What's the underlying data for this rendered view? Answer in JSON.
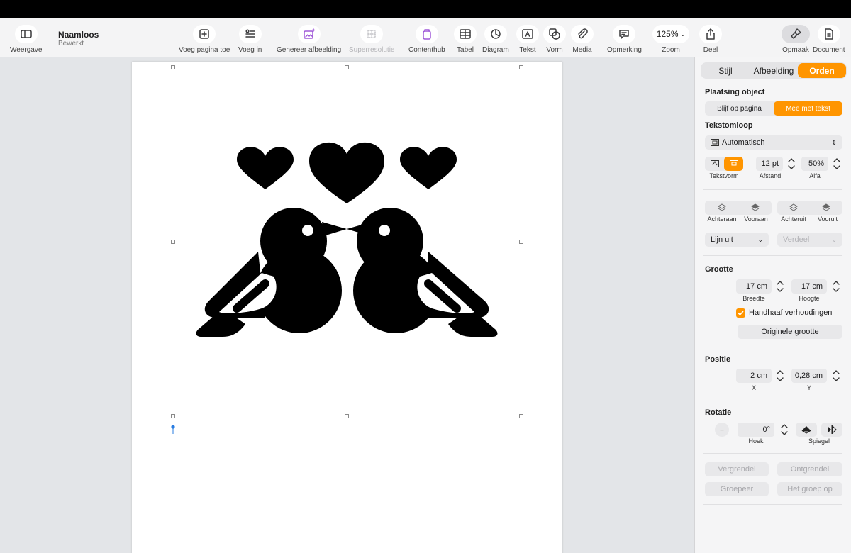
{
  "toolbar": {
    "view_label": "Weergave",
    "doc_title": "Naamloos",
    "doc_status": "Bewerkt",
    "add_page_label": "Voeg pagina toe",
    "insert_label": "Voeg in",
    "generate_image_label": "Genereer afbeelding",
    "super_resolution_label": "Superresolutie",
    "content_hub_label": "Contenthub",
    "table_label": "Tabel",
    "chart_label": "Diagram",
    "text_label": "Tekst",
    "shape_label": "Vorm",
    "media_label": "Media",
    "comment_label": "Opmerking",
    "zoom_value": "125%",
    "zoom_label": "Zoom",
    "share_label": "Deel",
    "format_label": "Opmaak",
    "document_label": "Document"
  },
  "sidebar": {
    "tabs": [
      "Stijl",
      "Afbeelding",
      "Orden"
    ],
    "placement_title": "Plaatsing object",
    "placement_options": [
      "Blijf op pagina",
      "Mee met tekst"
    ],
    "wrap_title": "Tekstomloop",
    "wrap_value": "Automatisch",
    "text_shape_label": "Tekstvorm",
    "spacing_value": "12 pt",
    "spacing_label": "Afstand",
    "alpha_value": "50%",
    "alpha_label": "Alfa",
    "back_label": "Achteraan",
    "front_label": "Vooraan",
    "backward_label": "Achteruit",
    "forward_label": "Vooruit",
    "align_label": "Lijn uit",
    "distribute_label": "Verdeel",
    "size_title": "Grootte",
    "width_value": "17 cm",
    "width_label": "Breedte",
    "height_value": "17 cm",
    "height_label": "Hoogte",
    "constrain_label": "Handhaaf verhoudingen",
    "original_size_label": "Originele grootte",
    "position_title": "Positie",
    "x_value": "2 cm",
    "x_label": "X",
    "y_value": "0,28 cm",
    "y_label": "Y",
    "rotation_title": "Rotatie",
    "angle_value": "0°",
    "angle_label": "Hoek",
    "flip_label": "Spiegel",
    "lock_label": "Vergrendel",
    "unlock_label": "Ontgrendel",
    "group_label": "Groepeer",
    "ungroup_label": "Hef groep op"
  },
  "colors": {
    "accent": "#ff9500",
    "image_fill": "#000000"
  }
}
